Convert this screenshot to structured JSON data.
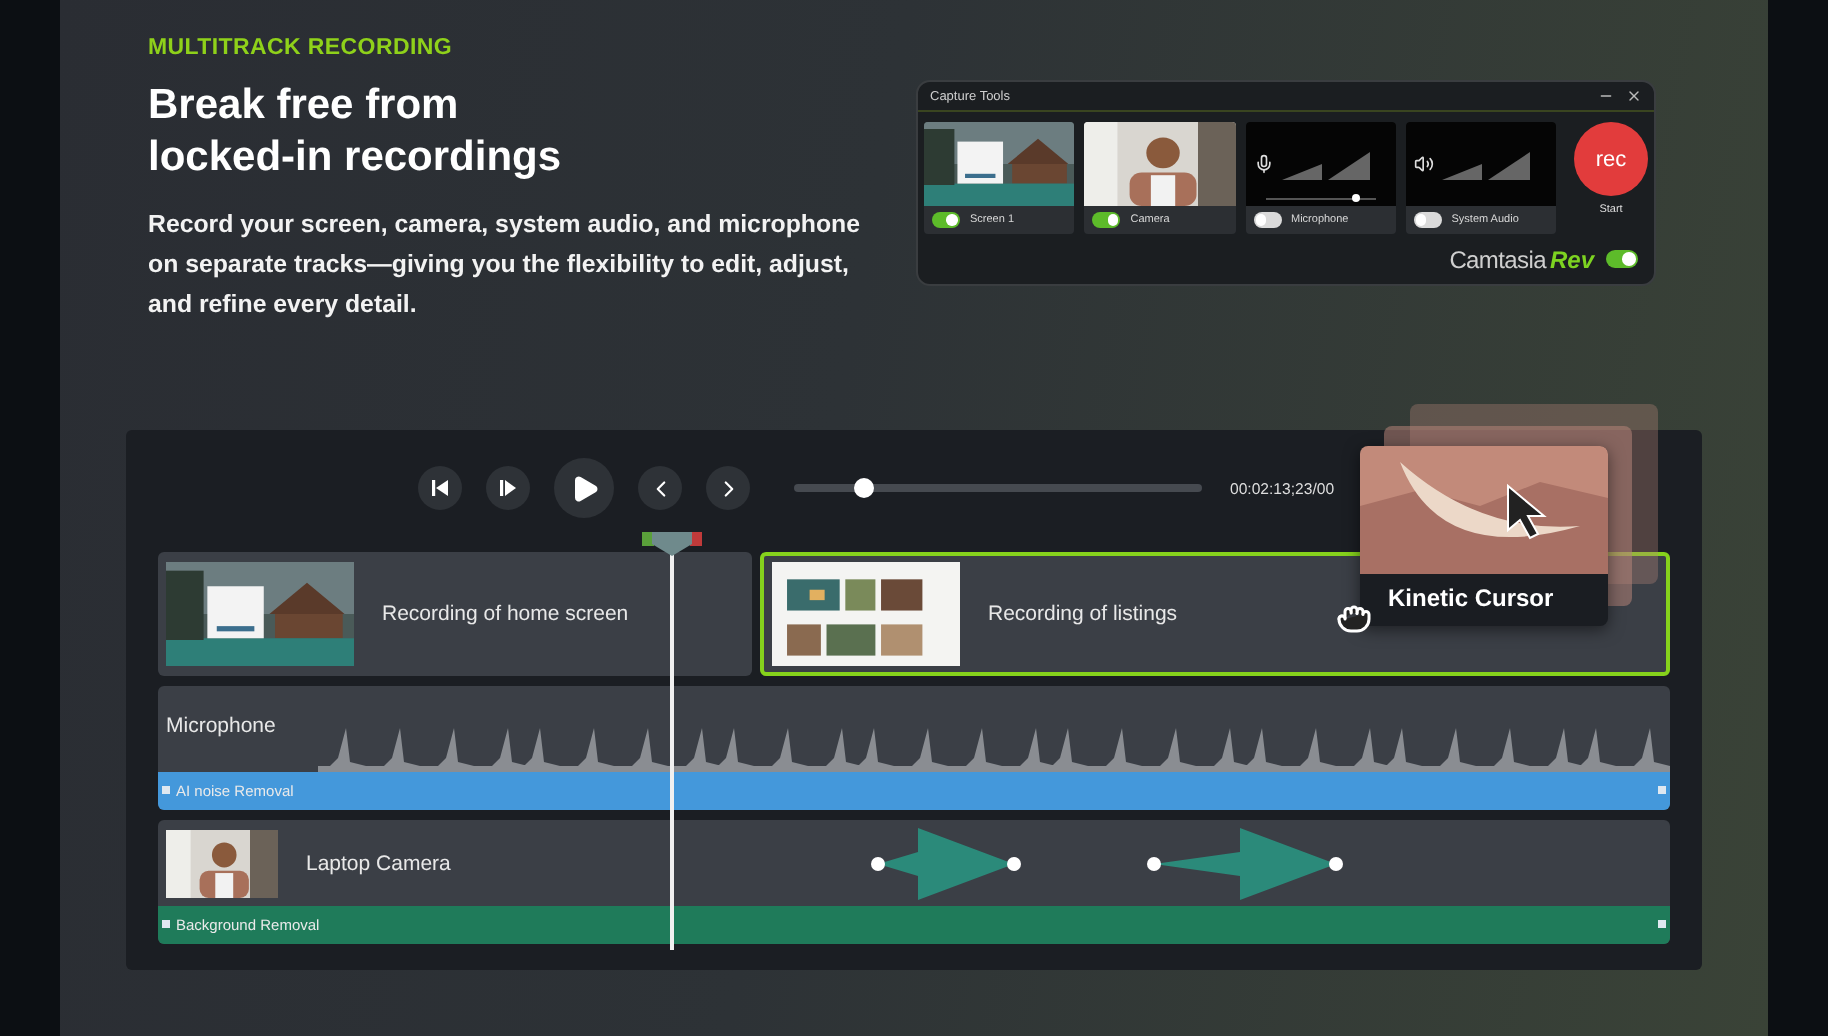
{
  "eyebrow": "MULTITRACK RECORDING",
  "headline": [
    "Break free from",
    "locked-in recordings"
  ],
  "description": "Record your screen, camera, system audio, and microphone on separate tracks—giving you the flexibility to edit, adjust, and refine every detail.",
  "capture_tools": {
    "title": "Capture Tools",
    "tiles": [
      {
        "kind": "screen",
        "label": "Screen 1",
        "on": true
      },
      {
        "kind": "camera",
        "label": "Camera",
        "on": true
      },
      {
        "kind": "microphone",
        "label": "Microphone",
        "on": false,
        "level": 0.83
      },
      {
        "kind": "system_audio",
        "label": "System Audio",
        "on": false
      }
    ],
    "rec_button": "rec",
    "start_label": "Start",
    "logo": {
      "name": "Camtasia",
      "suffix": "Rev"
    },
    "rev_on": true
  },
  "player": {
    "level": 0.17,
    "timecode": "00:02:13;23/00"
  },
  "kinetic_card": {
    "label": "Kinetic Cursor"
  },
  "clips": [
    {
      "label": "Recording of home screen",
      "selected": false
    },
    {
      "label": "Recording of listings",
      "selected": true
    }
  ],
  "tracks": [
    {
      "kind": "audio",
      "label": "Microphone",
      "effect": "AI noise Removal",
      "color": "#4498db"
    },
    {
      "kind": "camera",
      "label": "Laptop Camera",
      "effect": "Background Removal",
      "color": "#1f7b5a"
    }
  ]
}
